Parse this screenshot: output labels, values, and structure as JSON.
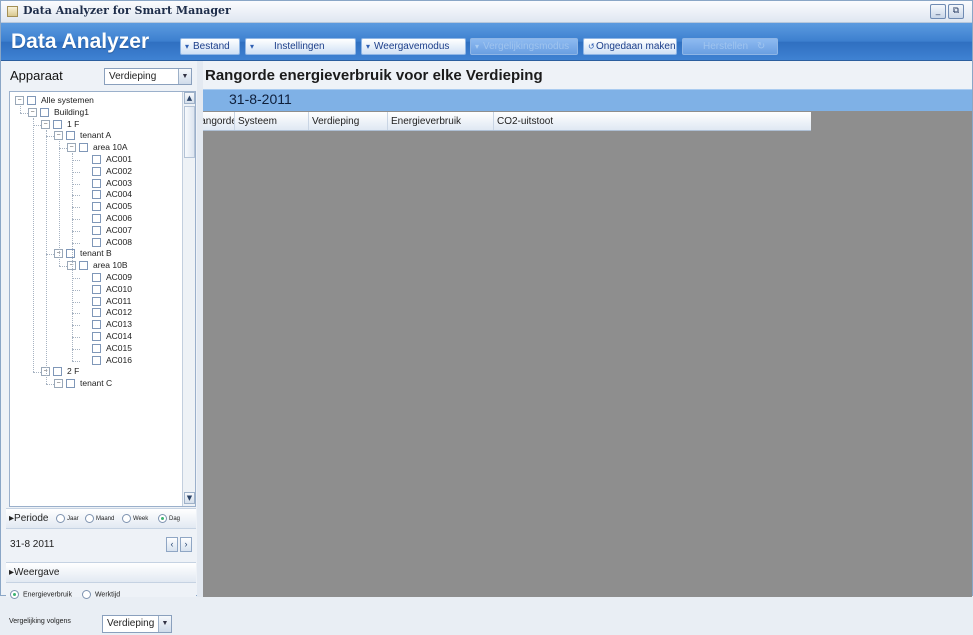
{
  "window": {
    "title": "Data Analyzer for Smart Manager",
    "minimize": "_",
    "restore": "⧉"
  },
  "header": {
    "brand": "Data Analyzer",
    "buttons": {
      "bestand": "Bestand",
      "instellingen": "Instellingen",
      "weergavemodus": "Weergavemodus",
      "vergelijkingsmodus": "Vergelijkingsmodus",
      "ongedaan": "Ongedaan maken",
      "herstellen": "Herstellen"
    }
  },
  "left": {
    "apparaat_label": "Apparaat",
    "apparaat_value": "Verdieping",
    "tree": [
      {
        "label": "Alle systemen",
        "level": 0,
        "expander": "−"
      },
      {
        "label": "Building1",
        "level": 1,
        "expander": "−"
      },
      {
        "label": "1 F",
        "level": 2,
        "expander": "−"
      },
      {
        "label": "tenant A",
        "level": 3,
        "expander": "−"
      },
      {
        "label": "area 10A",
        "level": 4,
        "expander": "−"
      },
      {
        "label": "AC001",
        "level": 5
      },
      {
        "label": "AC002",
        "level": 5
      },
      {
        "label": "AC003",
        "level": 5
      },
      {
        "label": "AC004",
        "level": 5
      },
      {
        "label": "AC005",
        "level": 5
      },
      {
        "label": "AC006",
        "level": 5
      },
      {
        "label": "AC007",
        "level": 5
      },
      {
        "label": "AC008",
        "level": 5
      },
      {
        "label": "tenant B",
        "level": 3,
        "expander": "−"
      },
      {
        "label": "area 10B",
        "level": 4,
        "expander": "−"
      },
      {
        "label": "AC009",
        "level": 5
      },
      {
        "label": "AC010",
        "level": 5
      },
      {
        "label": "AC011",
        "level": 5
      },
      {
        "label": "AC012",
        "level": 5
      },
      {
        "label": "AC013",
        "level": 5
      },
      {
        "label": "AC014",
        "level": 5
      },
      {
        "label": "AC015",
        "level": 5
      },
      {
        "label": "AC016",
        "level": 5
      },
      {
        "label": "2 F",
        "level": 2,
        "expander": "−"
      },
      {
        "label": "tenant C",
        "level": 3,
        "expander": "−"
      }
    ],
    "periode": {
      "label": "▸Periode",
      "options": [
        "Jaar",
        "Maand",
        "Week",
        "Dag"
      ],
      "selected": "Dag"
    },
    "date": "31-8 2011",
    "weergave": {
      "label": "▸Weergave",
      "options": [
        "Energieverbruik",
        "Werktijd"
      ],
      "selected": "Energieverbruik"
    },
    "vergelijking": {
      "label": "Vergelijking volgens",
      "value": "Verdieping"
    }
  },
  "main": {
    "title": "Rangorde energieverbruik voor elke Verdieping",
    "date": "31-8-2011",
    "columns": [
      "Rangorde",
      "Systeem",
      "Verdieping",
      "Energieverbruik",
      "CO2-uitstoot"
    ]
  },
  "colors": {
    "header_blue": "#3c7fce",
    "date_band": "#7fb1e6",
    "grid_empty": "#8e8e8e"
  }
}
